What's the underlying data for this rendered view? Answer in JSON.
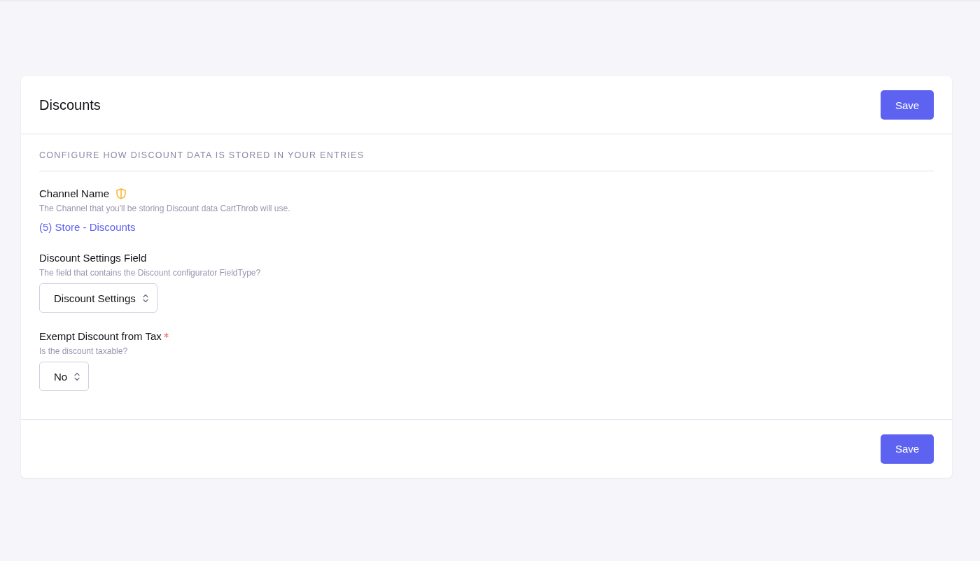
{
  "panel": {
    "title": "Discounts",
    "header_button": "Save",
    "section_heading": "CONFIGURE HOW DISCOUNT DATA IS STORED IN YOUR ENTRIES",
    "fields": [
      {
        "kind": "link",
        "label": "Channel Name",
        "has_icon": true,
        "required": false,
        "description": "The Channel that you'll be storing Discount data CartThrob will use.",
        "value": "(5) Store - Discounts"
      },
      {
        "kind": "select",
        "label": "Discount Settings Field",
        "has_icon": false,
        "required": false,
        "description": "The field that contains the Discount configurator FieldType?",
        "value": "Discount Settings"
      },
      {
        "kind": "select",
        "label": "Exempt Discount from Tax",
        "has_icon": false,
        "required": true,
        "description": "Is the discount taxable?",
        "value": "No"
      }
    ],
    "footer_button": "Save"
  }
}
